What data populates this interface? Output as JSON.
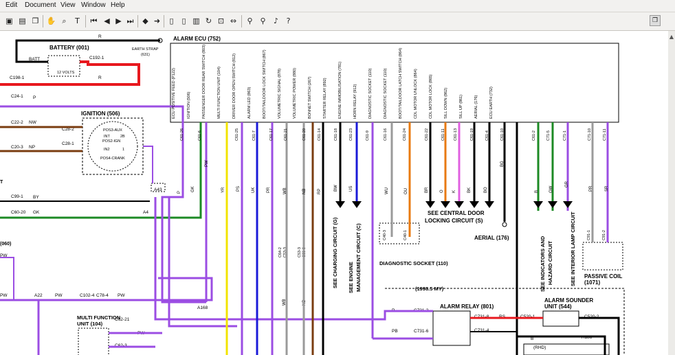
{
  "menu": [
    "Edit",
    "Document",
    "View",
    "Window",
    "Help"
  ],
  "toolbar_icons": [
    "save-icon",
    "print-icon",
    "copy-icon",
    "hand-tool-icon",
    "zoom-icon",
    "select-text-icon",
    "first-page-icon",
    "previous-page-icon",
    "next-page-icon",
    "last-page-icon",
    "back-icon",
    "forward-icon",
    "single-page-icon",
    "continuous-page-icon",
    "facing-pages-icon",
    "rotate-icon",
    "fit-page-icon",
    "fit-width-icon",
    "find-icon",
    "find-next-icon",
    "read-aloud-icon",
    "help-icon"
  ],
  "colors": {
    "purple": "#9b4de3",
    "green": "#1c8a24",
    "yellow": "#f2e300",
    "red": "#e8181e",
    "blue": "#1a1ad8",
    "brown": "#7a3c10",
    "orange": "#e87a10",
    "pink": "#e060e0",
    "grey": "#9a9a9a",
    "black": "#000000"
  },
  "ecu": {
    "title": "ALARM ECU (752)",
    "pins": [
      {
        "label": "ECU POSITIVE FEED (P122)",
        "pin": "C61-26",
        "wire": "P"
      },
      {
        "label": "IGNITION (506)",
        "pin": "C61-6",
        "wire": "GK"
      },
      {
        "label": "PASSENGER DOOR REAR SWITCH (803)",
        "pin": "",
        "wire": "PW"
      },
      {
        "label": "MULTI FUNCTION UNIT (104)",
        "pin": "C61-25",
        "wire": "YR"
      },
      {
        "label": "DRIVER DOOR OPEN SWITCH (812)",
        "pin": "C61-7",
        "wire": "PS"
      },
      {
        "label": "ALARM LED (863)",
        "pin": "C61-17",
        "wire": "UK"
      },
      {
        "label": "BOOT/TAILDOOR LOCK SWITCH (867)",
        "pin": "C61-21",
        "wire": "PR"
      },
      {
        "label": "VOLUMETRIC SIGNAL (878)",
        "pin": "C61-20",
        "wire": "WB"
      },
      {
        "label": "VOLUMETRIC POWER (880)",
        "pin": "C61-14",
        "wire": "NB"
      },
      {
        "label": "BONNET SWITCH (267)",
        "pin": "C61-18",
        "wire": "RP"
      },
      {
        "label": "STARTER RELAY (892)",
        "pin": "C61-23",
        "wire": "BW"
      },
      {
        "label": "ENGINE IMMOBILISATION (781)",
        "pin": "C61-9",
        "wire": "US"
      },
      {
        "label": "HORN RELAY (912)",
        "pin": "C61-16",
        "wire": "WU"
      },
      {
        "label": "DIAGNOSTIC SOCKET (110)",
        "pin": "C61-24",
        "wire": "OU"
      },
      {
        "label": "DIAGNOSTIC SOCKET (110)",
        "pin": "C61-22",
        "wire": "BR"
      },
      {
        "label": "BOOT/TAILDOOR LATCH SWITCH (864)",
        "pin": "C61-11",
        "wire": "O"
      },
      {
        "label": "CDL MOTOR UNLOCK (864)",
        "pin": "C61-13",
        "wire": "K"
      },
      {
        "label": "CDL MOTOR LOCK (865)",
        "pin": "C61-19",
        "wire": "BK"
      },
      {
        "label": "SILL DOWN (862)",
        "pin": "C61-4",
        "wire": "BO"
      },
      {
        "label": "SILL UP (861)",
        "pin": "C61-10",
        "wire": "BG"
      },
      {
        "label": "AERIAL (176)",
        "pin": "C61-2",
        "wire": "B"
      },
      {
        "label": "ECU EARTH (732)",
        "pin": "C71-5",
        "wire": "GW"
      },
      {
        "label": "",
        "pin": "C71-1",
        "wire": "GR"
      },
      {
        "label": "",
        "pin": "C71-10",
        "wire": "PR"
      },
      {
        "label": "",
        "pin": "C71-11",
        "wire": "SR"
      },
      {
        "label": "",
        "pin": "C71-12",
        "wire": "PK"
      }
    ]
  },
  "battery": {
    "title": "BATTERY (001)",
    "batt": "BATT",
    "volts": "12 VOLTS",
    "c1921": "C192-1",
    "c1981": "C198-1",
    "r1": "R",
    "r2": "R",
    "earth_strap": "EARTH STRAP",
    "earth_num": "(631)"
  },
  "ignition": {
    "title": "IGNITION (506)",
    "pos3": "POS3-AUX",
    "pos2": "POS2-IGN",
    "pos4": "POS4-CRANK",
    "int": "INT",
    "in2": "IN2",
    "n2b": "2B",
    "n1": "1",
    "c282": "C28-2",
    "c281": "C28-1",
    "c222": "C22-2",
    "c203": "C20-3",
    "nw": "NW",
    "np": "NP",
    "c241": "C24-1",
    "p": "P"
  },
  "left": {
    "t": "T",
    "c991": "C99-1",
    "by": "BY",
    "c6020": "C60-20",
    "gk": "GK",
    "a4": "A4",
    "a43": "A43",
    "n060": "(060)",
    "pw1": "PW",
    "pw2": "PW",
    "a22": "A22",
    "pw3": "PW",
    "c1024": "C102-4",
    "c784": "C78-4",
    "pw4": "PW",
    "a168": "A168"
  },
  "mfu": {
    "title": "MULTI FUNCTION",
    "title2": "UNIT (104)",
    "c6221": "C62-21",
    "c623": "C62-3",
    "pw": "PW"
  },
  "circuits": {
    "charging": "SEE CHARGING CIRCUIT (G)",
    "engine1": "SEE ENGINE",
    "engine2": "MANAGEMENT CIRCUIT (C)",
    "cdl1": "SEE CENTRAL DOOR",
    "cdl2": "LOCKING CIRCUIT (S)",
    "ind1": "SEE INDICATORS AND",
    "ind2": "HAZARD CIRCUIT",
    "interior": "SEE INTERIOR LAMP CIRCUIT"
  },
  "diag": {
    "title": "DIAGNOSTIC SOCKET (110)",
    "c403": "C40-3",
    "c401": "C40-1"
  },
  "aerial": {
    "title": "AERIAL (176)"
  },
  "vol": {
    "c642": "C64-2",
    "c533": "C53-3",
    "c533b": "C53-3",
    "c535": "C53-5"
  },
  "passive": {
    "title": "PASSIVE COIL",
    "num": "(1071)",
    "c911": "C91-1",
    "c912": "C91-2"
  },
  "relay": {
    "title": "ALARM RELAY (801)",
    "my": "(1998.5 MY)",
    "p": "P",
    "c7312": "C731-2",
    "pb": "PB",
    "c7316": "C731-6",
    "c7318": "C731-8",
    "rs": "RS",
    "c7314": "C731-4",
    "b": "B",
    "wb": "WB",
    "nb": "NB"
  },
  "sounder": {
    "title": "ALARM SOUNDER",
    "title2": "UNIT (544)",
    "c5201": "C520-1",
    "c5202": "C520-2",
    "b": "B",
    "a186": "A186",
    "rhd": "(RHD)"
  }
}
